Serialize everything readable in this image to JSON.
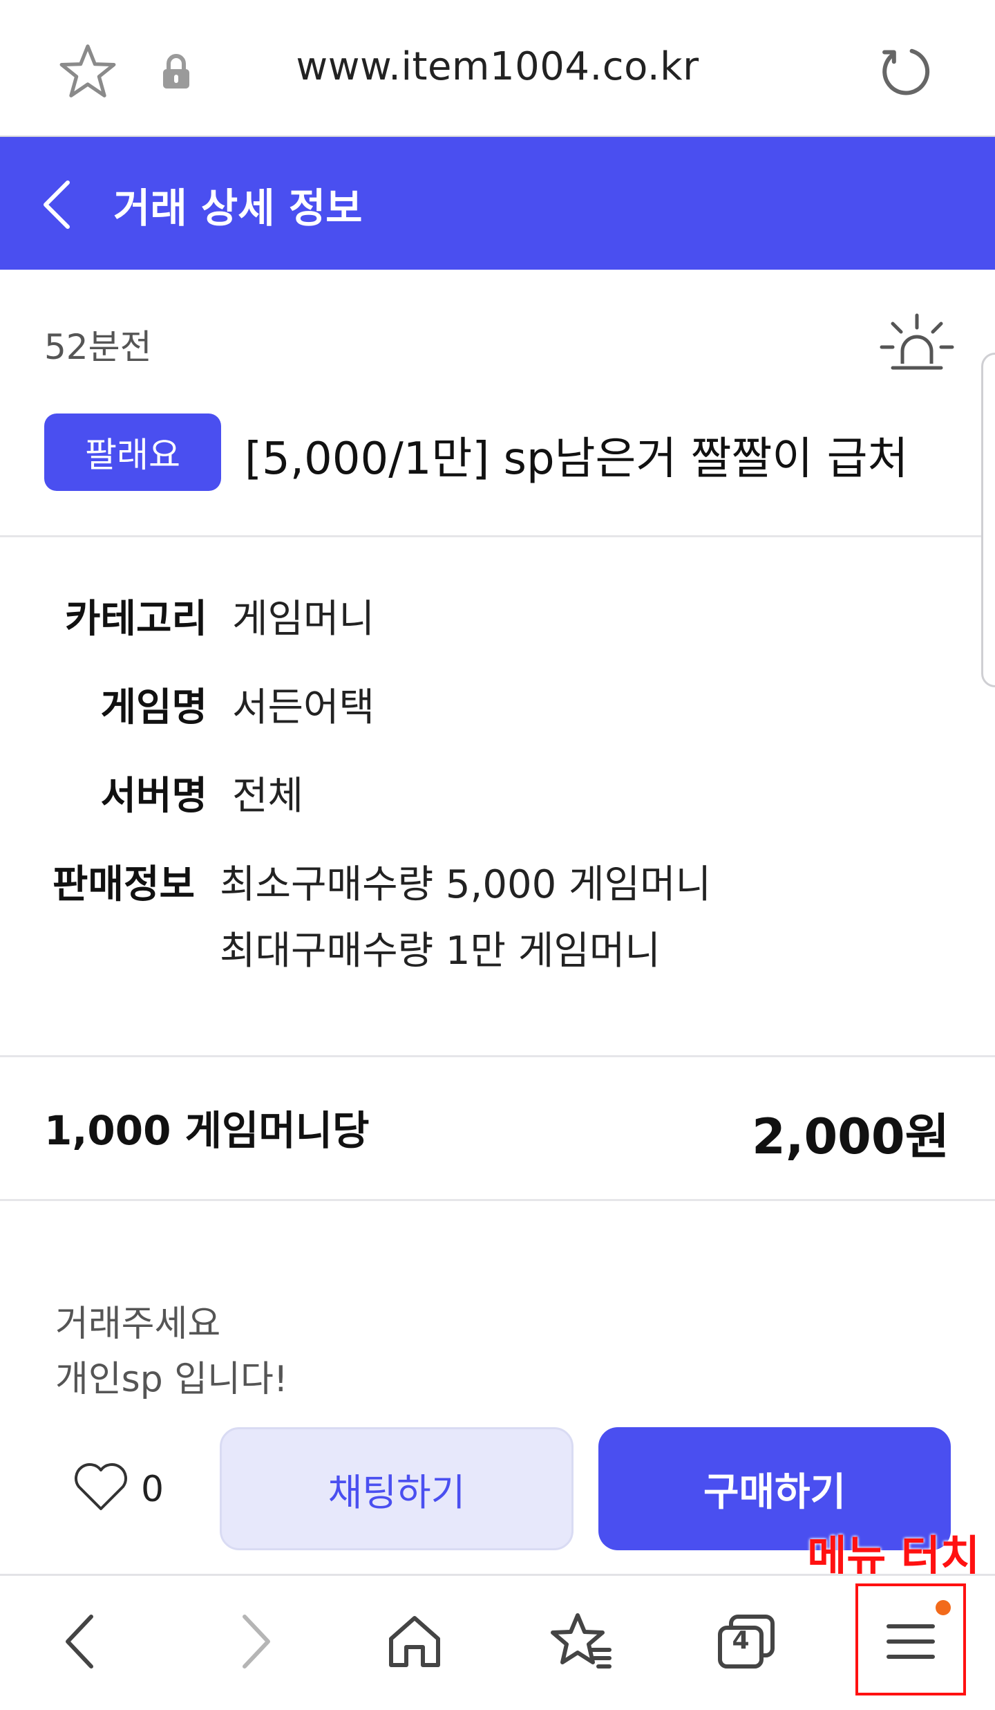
{
  "browser": {
    "url": "www.item1004.co.kr",
    "icons": [
      "star-icon",
      "lock-icon",
      "reload-icon"
    ]
  },
  "header": {
    "title": "거래 상세 정보",
    "back_icon": "chevron-left-icon"
  },
  "post": {
    "time_ago": "52분전",
    "report_icon": "siren-icon",
    "badge": "팔래요",
    "title": "[5,000/1만] sp남은거 짤짤이 급처"
  },
  "details": {
    "category_label": "카테고리",
    "category_value": "게임머니",
    "game_label": "게임명",
    "game_value": "서든어택",
    "server_label": "서버명",
    "server_value": "전체",
    "sale_label": "판매정보",
    "sale_line1": "최소구매수량 5,000 게임머니",
    "sale_line2": "최대구매수량 1만 게임머니"
  },
  "price": {
    "unit": "1,000 게임머니당",
    "value": "2,000원"
  },
  "description": {
    "line1": "거래주세요",
    "line2": "개인sp 입니다!"
  },
  "actions": {
    "like_count": "0",
    "chat_label": "채팅하기",
    "buy_label": "구매하기"
  },
  "annotation": {
    "text": "메뉴 터치",
    "color": "#ff1111"
  },
  "bottom_nav": {
    "items": [
      "back-icon",
      "forward-icon",
      "home-icon",
      "bookmarks-icon",
      "tabs-icon",
      "menu-icon"
    ],
    "tab_count": "4"
  },
  "colors": {
    "accent": "#4a4ff0",
    "chat_bg": "#e7e8fb",
    "notification_dot": "#f26a1b"
  }
}
